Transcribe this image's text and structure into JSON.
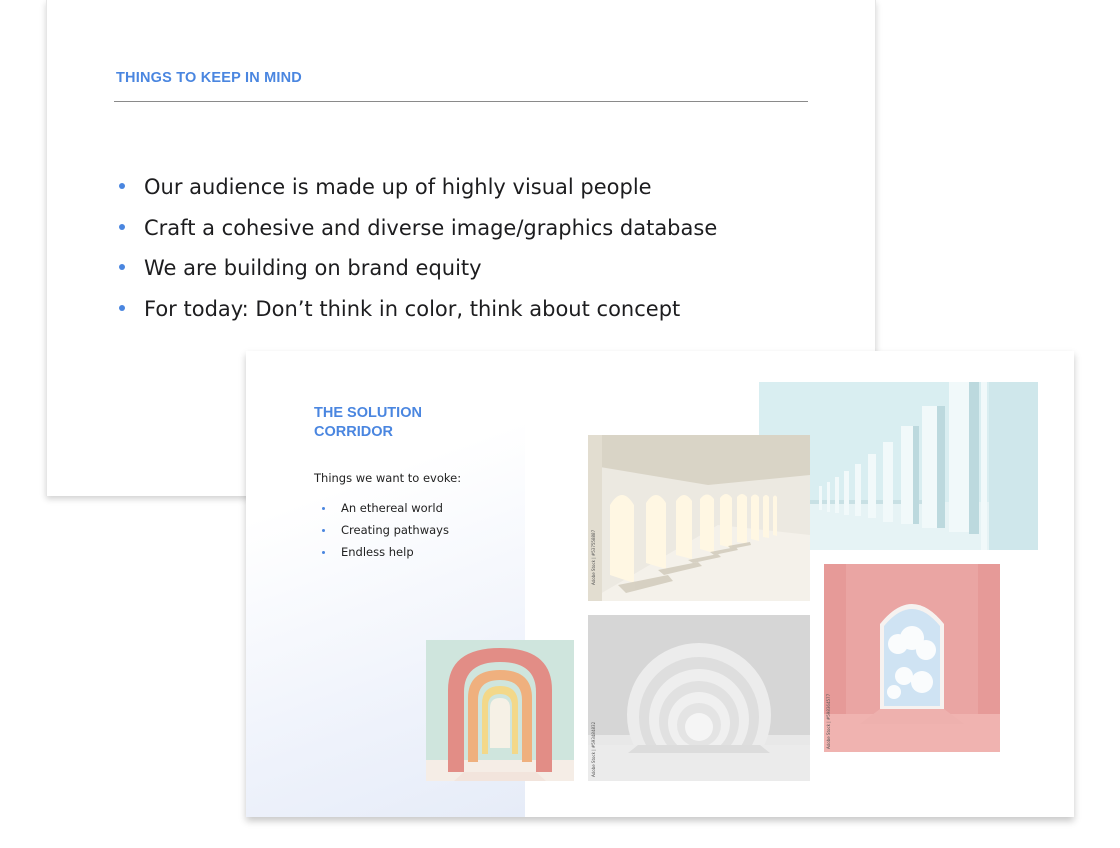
{
  "slide1": {
    "title": "THINGS TO KEEP IN MIND",
    "bullets": [
      "Our audience is made up of highly visual people",
      "Craft a cohesive and diverse image/graphics database",
      "We are building on brand equity",
      "For today: Don’t think in color, think about concept"
    ]
  },
  "slide2": {
    "title": "THE SOLUTION CORRIDOR",
    "subtitle": "Things we want to evoke:",
    "bullets": [
      "An ethereal world",
      "Creating pathways",
      "Endless help"
    ],
    "photos": [
      {
        "name": "blue-columns-corridor-photo"
      },
      {
        "name": "sunlit-arches-corridor-photo",
        "credit": "Adobe Stock | #537558887"
      },
      {
        "name": "pink-room-cloud-window-photo",
        "credit": "Adobe Stock | #598364577"
      },
      {
        "name": "white-tunnel-photo",
        "credit": "Adobe Stock | #593484832"
      },
      {
        "name": "pastel-arches-photo"
      }
    ]
  },
  "colors": {
    "accent": "#4a86e0",
    "text": "#1d1d1f",
    "pink": "#e8a9a7",
    "mint": "#cfe5de",
    "sky": "#d8edf0"
  }
}
